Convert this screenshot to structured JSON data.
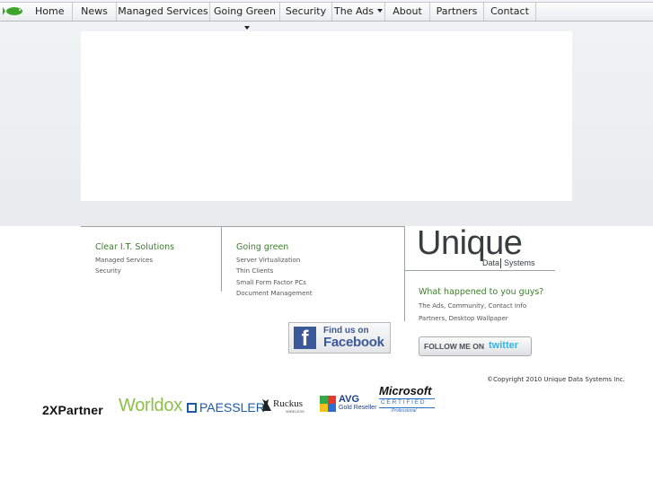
{
  "nav": {
    "items": [
      {
        "label": "Home"
      },
      {
        "label": "News"
      },
      {
        "label": "Managed Services"
      },
      {
        "label": "Going Green"
      },
      {
        "label": "Security"
      },
      {
        "label": "The Ads"
      },
      {
        "label": "About"
      },
      {
        "label": "Partners"
      },
      {
        "label": "Contact"
      }
    ]
  },
  "footer": {
    "col1": {
      "title": "Clear I.T. Solutions",
      "links": [
        "Managed Services",
        "Security"
      ]
    },
    "col2": {
      "title": "Going green",
      "links": [
        "Server Virtualization",
        "Thin Clients",
        "Small Form Factor PCs",
        "Document Management"
      ]
    },
    "brand": {
      "line1": "Unique",
      "line2": "Data",
      "line3": "Systems"
    },
    "col3": {
      "title": "What happened to you guys?",
      "row1": [
        "The Ads",
        "Community",
        "Contact Info"
      ],
      "row2": [
        "Partners",
        "Desktop Wallpaper"
      ],
      "sep": ","
    },
    "facebook": {
      "line1": "Find us on",
      "line2": "Facebook",
      "icon": "f"
    },
    "twitter": {
      "line1": "FOLLOW ME ON",
      "line2": "twitter"
    },
    "copyright": "©Copyright 2010 Unique Data Systems Inc."
  },
  "partners": {
    "twox": "2XPartner",
    "worldox": "Worldox",
    "paessler": "PAESSLER",
    "ruckus_name": "Ruckus",
    "ruckus_sub": "WIRELESS",
    "avg_name": "AVG",
    "avg_sub": "Gold Reseller",
    "ms_name": "Microsoft",
    "ms_cert": "CERTIFIED",
    "ms_sub": "Professional"
  },
  "colors": {
    "accent_green": "#3d7f2b",
    "facebook": "#3b5998",
    "twitter": "#33b6e4"
  }
}
